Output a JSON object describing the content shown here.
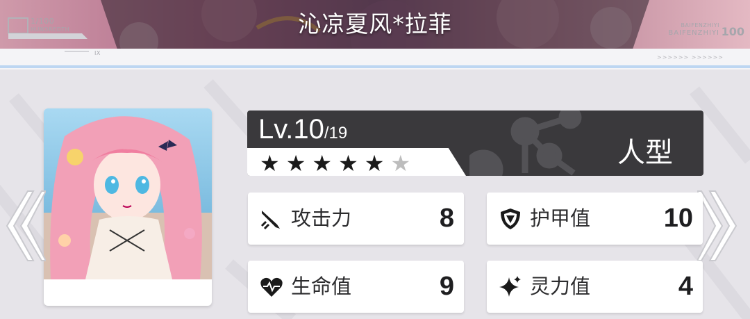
{
  "header": {
    "title": "沁凉夏风*拉菲",
    "left_code": "1/100",
    "left_word": "HUNDREDTH",
    "left_tag": "IX",
    "right_code": "BAIFENZHIYI",
    "right_small": "BAIFENZHIYI",
    "right_num": "100"
  },
  "level": {
    "label": "Lv.10",
    "max": "/19",
    "type": "人型",
    "stars_total": 6,
    "stars_filled": 5,
    "star_glyph": "★"
  },
  "stats": [
    {
      "icon": "attack-icon",
      "label": "攻击力",
      "value": "8"
    },
    {
      "icon": "armor-icon",
      "label": "护甲值",
      "value": "10"
    },
    {
      "icon": "health-icon",
      "label": "生命值",
      "value": "9"
    },
    {
      "icon": "spirit-icon",
      "label": "灵力值",
      "value": "4"
    }
  ],
  "colors": {
    "panel_dark": "#3a393c",
    "star_filled": "#1a1a1a",
    "star_empty": "#bdbdbd",
    "accent_blue": "#bdd6f2"
  },
  "portrait": {
    "icon": "character-portrait"
  }
}
